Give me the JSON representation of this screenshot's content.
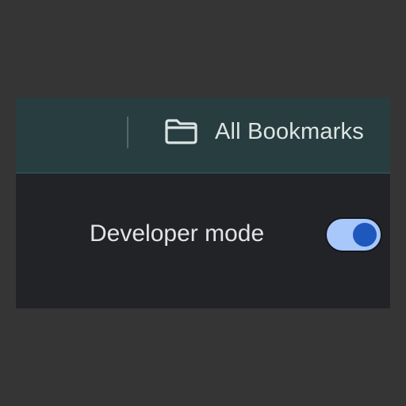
{
  "bookmarks_bar": {
    "all_bookmarks_label": "All Bookmarks",
    "all_bookmarks_icon": "folder-icon"
  },
  "settings": {
    "developer_mode_label": "Developer mode",
    "developer_mode_enabled": true
  },
  "colors": {
    "bookmarks_bar_bg": "#273d40",
    "content_bg": "#212327",
    "toggle_track": "#a8c7fa",
    "toggle_knob": "#1f58bd"
  }
}
